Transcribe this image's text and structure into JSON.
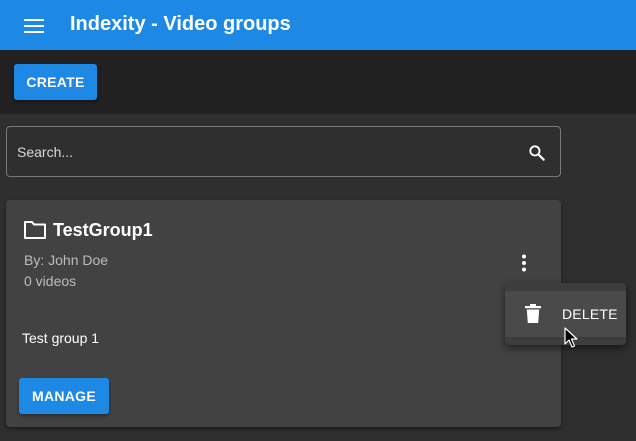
{
  "app": {
    "title": "Indexity - Video groups",
    "brand_color": "#1e88e5"
  },
  "toolbar": {
    "create_label": "CREATE"
  },
  "search": {
    "placeholder": "Search...",
    "value": "",
    "icon": "search-icon"
  },
  "groups": [
    {
      "name": "TestGroup1",
      "author": "By: John Doe",
      "video_count": "0 videos",
      "description": "Test group 1",
      "manage_label": "MANAGE",
      "icon": "folder-icon"
    }
  ],
  "context_menu": {
    "items": [
      {
        "label": "DELETE",
        "icon": "trash-icon"
      }
    ]
  }
}
